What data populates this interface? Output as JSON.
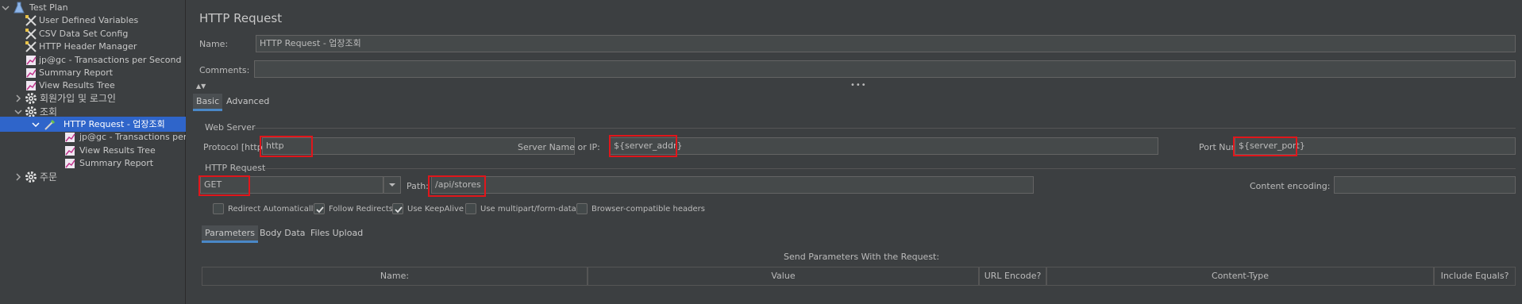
{
  "tree": {
    "items": [
      {
        "label": "Test Plan",
        "icon": "flask-icon"
      },
      {
        "label": "User Defined Variables",
        "icon": "tools-icon"
      },
      {
        "label": "CSV Data Set Config",
        "icon": "tools-icon"
      },
      {
        "label": "HTTP Header Manager",
        "icon": "tools-icon"
      },
      {
        "label": "jp@gc - Transactions per Second",
        "icon": "graph-icon"
      },
      {
        "label": "Summary Report",
        "icon": "graph-icon"
      },
      {
        "label": "View Results Tree",
        "icon": "graph-icon"
      },
      {
        "label": "회원가입 및 로그인",
        "icon": "gear-icon"
      },
      {
        "label": "조회",
        "icon": "gear-icon"
      },
      {
        "label": "HTTP Request - 업장조회",
        "icon": "pipette-icon"
      },
      {
        "label": "jp@gc - Transactions per",
        "icon": "graph-icon"
      },
      {
        "label": "View Results Tree",
        "icon": "graph-icon"
      },
      {
        "label": "Summary Report",
        "icon": "graph-icon"
      },
      {
        "label": "주문",
        "icon": "gear-icon"
      }
    ]
  },
  "panel": {
    "title": "HTTP Request",
    "name_label": "Name:",
    "name_value": "HTTP Request - 업장조회",
    "comments_label": "Comments:",
    "comments_value": ""
  },
  "tabs": {
    "basic": "Basic",
    "advanced": "Advanced"
  },
  "web_server": {
    "section_label": "Web Server",
    "protocol_label": "Protocol [http]:",
    "protocol_value": "http",
    "server_label": "Server Name or IP:",
    "server_value": "${server_addr}",
    "port_label": "Port Number:",
    "port_value": "${server_port}"
  },
  "http_request": {
    "section_label": "HTTP Request",
    "method_value": "GET",
    "path_label": "Path:",
    "path_value": "/api/stores",
    "encoding_label": "Content encoding:",
    "encoding_value": ""
  },
  "options": [
    {
      "label": "Redirect Automatically",
      "checked": false
    },
    {
      "label": "Follow Redirects",
      "checked": true
    },
    {
      "label": "Use KeepAlive",
      "checked": true
    },
    {
      "label": "Use multipart/form-data",
      "checked": false
    },
    {
      "label": "Browser-compatible headers",
      "checked": false
    }
  ],
  "sub_tabs": {
    "parameters": "Parameters",
    "body_data": "Body Data",
    "files_upload": "Files Upload"
  },
  "params_table": {
    "caption": "Send Parameters With the Request:",
    "columns": [
      "Name:",
      "Value",
      "URL Encode?",
      "Content-Type",
      "Include Equals?"
    ]
  },
  "colors": {
    "background": "#3c3f41",
    "selection": "#2f65ca",
    "highlight_box": "#e0161b",
    "tab_accent": "#4a88c7"
  }
}
